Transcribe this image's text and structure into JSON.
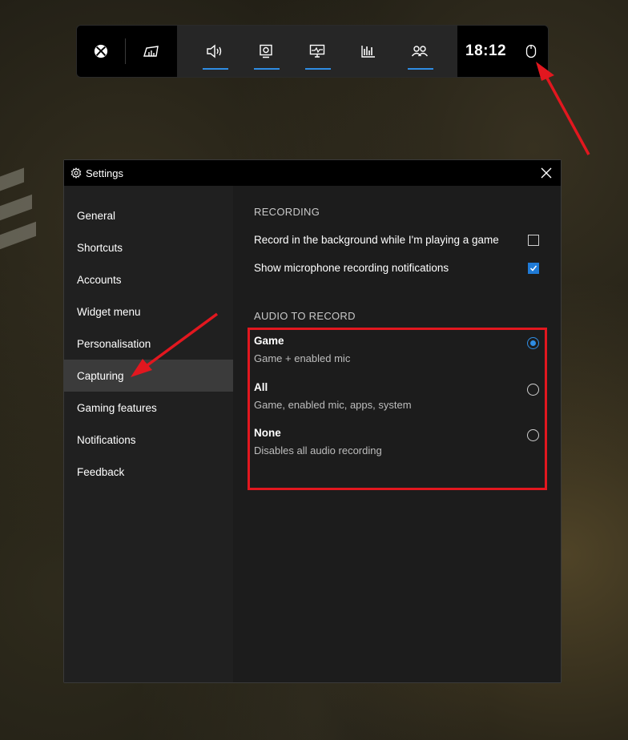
{
  "gamebar": {
    "time": "18:12",
    "accent_color": "#2f8de4",
    "items": [
      "audio-icon",
      "capture-icon",
      "performance-icon",
      "resources-icon",
      "social-icon"
    ]
  },
  "settings": {
    "title": "Settings",
    "nav": [
      {
        "label": "General"
      },
      {
        "label": "Shortcuts"
      },
      {
        "label": "Accounts"
      },
      {
        "label": "Widget menu"
      },
      {
        "label": "Personalisation"
      },
      {
        "label": "Capturing"
      },
      {
        "label": "Gaming features"
      },
      {
        "label": "Notifications"
      },
      {
        "label": "Feedback"
      }
    ],
    "active_nav": "Capturing",
    "recording": {
      "heading": "RECORDING",
      "options": [
        {
          "label": "Record in the background while I'm playing a game",
          "checked": false
        },
        {
          "label": "Show microphone recording notifications",
          "checked": true
        }
      ]
    },
    "audio": {
      "heading": "AUDIO TO RECORD",
      "options": [
        {
          "title": "Game",
          "desc": "Game + enabled mic",
          "selected": true
        },
        {
          "title": "All",
          "desc": "Game, enabled mic, apps, system",
          "selected": false
        },
        {
          "title": "None",
          "desc": "Disables all audio recording",
          "selected": false
        }
      ]
    }
  },
  "annotation_color": "#e2171f"
}
